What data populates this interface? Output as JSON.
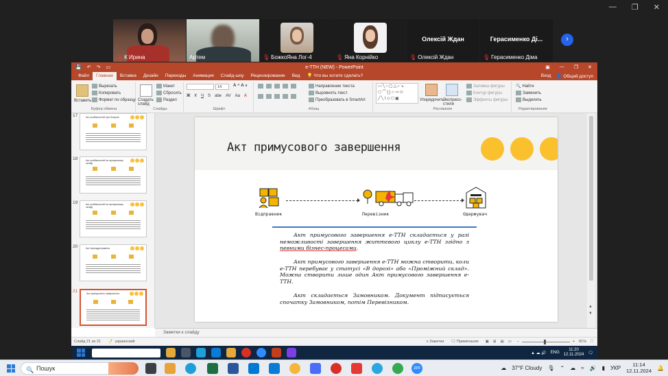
{
  "zoom": {
    "participants": [
      {
        "name": "К Ирина",
        "muted": true,
        "type": "video"
      },
      {
        "name": "Артем",
        "muted": false,
        "type": "video",
        "active": true
      },
      {
        "name": "БожкоЯна Лог-4",
        "muted": true,
        "type": "avatar"
      },
      {
        "name": "Яна Корнійко",
        "muted": true,
        "type": "avatar"
      },
      {
        "name": "Олексій Ждан",
        "muted": true,
        "type": "name",
        "big": "Олексій Ждан"
      },
      {
        "name": "Герасименко Діма",
        "muted": true,
        "type": "name",
        "big": "Герасименко Ді..."
      }
    ],
    "next_icon": "chevron-right-icon"
  },
  "ppt": {
    "doc_title": "е-ТТН (NEW)  -  PowerPoint",
    "tabs": [
      "Файл",
      "Главная",
      "Вставка",
      "Дизайн",
      "Переходы",
      "Анимация",
      "Слайд-шоу",
      "Рецензирование",
      "Вид",
      "Что вы хотите сделать?"
    ],
    "active_tab": "Главная",
    "signin": "Вход",
    "share": "Общий доступ",
    "ribbon": {
      "clipboard": {
        "paste": "Вставить",
        "cut": "Вырезать",
        "copy": "Копировать",
        "format": "Формат по образцу",
        "label": "Буфер обмена"
      },
      "slides": {
        "new": "Создать слайд",
        "layout": "Макет",
        "reset": "Сбросить",
        "section": "Раздел",
        "label": "Слайды"
      },
      "font": {
        "size": "14",
        "label": "Шрифт"
      },
      "paragraph": {
        "direction": "Направление текста",
        "align": "Выровнять текст",
        "smartart": "Преобразовать в SmartArt",
        "label": "Абзац"
      },
      "drawing": {
        "arrange": "Упорядочить",
        "styles": "Экспресс-стили",
        "fill": "Заливка фигуры",
        "outline": "Контур фигуры",
        "effects": "Эффекты фигуры",
        "label": "Рисование"
      },
      "editing": {
        "find": "Найти",
        "replace": "Заменить",
        "select": "Выделить",
        "label": "Редактирование"
      }
    },
    "thumbnails": [
      {
        "num": "17",
        "title": "Акт розбіжностей при бонусах"
      },
      {
        "num": "18",
        "title": "Акт розбіжностей на пропускному складі"
      },
      {
        "num": "19",
        "title": "Акт розбіжностей на пропускному складі"
      },
      {
        "num": "20",
        "title": "Акт переадресування"
      },
      {
        "num": "21",
        "title": "Акт примусового завершення"
      }
    ],
    "slide": {
      "title": "Акт примусового завершення",
      "labels": {
        "sender": "Відправник",
        "carrier": "Перевізник",
        "receiver": "Одержувач"
      },
      "p1_a": "Акт примусового завершення е-ТТН складається у разі неможливості завершення життєвого циклу е-ТТН згідно з ",
      "p1_u": "певними бізнес-процесами",
      "p1_b": ".",
      "p2": "Акт примусового завершення е-ТТН можна створити, коли е-ТТН перебуває у статусі «В дорозі» або «Проміжний склад». Можна створити лише один Акт примусового завершення е-ТТН.",
      "p3": "Акт складається Замовником. Документ підписується спочатку Замовником, потім Перевізником."
    },
    "notes_placeholder": "Заметки к слайду",
    "status": {
      "slide_of": "Слайд 21 из 21",
      "lang": "украинский",
      "notes": "Заметки",
      "comments": "Примечания",
      "zoom": "81%"
    }
  },
  "inner_taskbar": {
    "search": "",
    "time": "11:20",
    "date": "12.11.2024",
    "lang": "ENG"
  },
  "taskbar": {
    "search": "Пошук",
    "weather": "37°F  Cloudy",
    "lang": "УКР",
    "time": "11:14",
    "date": "12.11.2024"
  },
  "colors": {
    "ppt_accent": "#b7472a",
    "circle": "#fbc02d",
    "zoom_active": "#22c55e"
  }
}
